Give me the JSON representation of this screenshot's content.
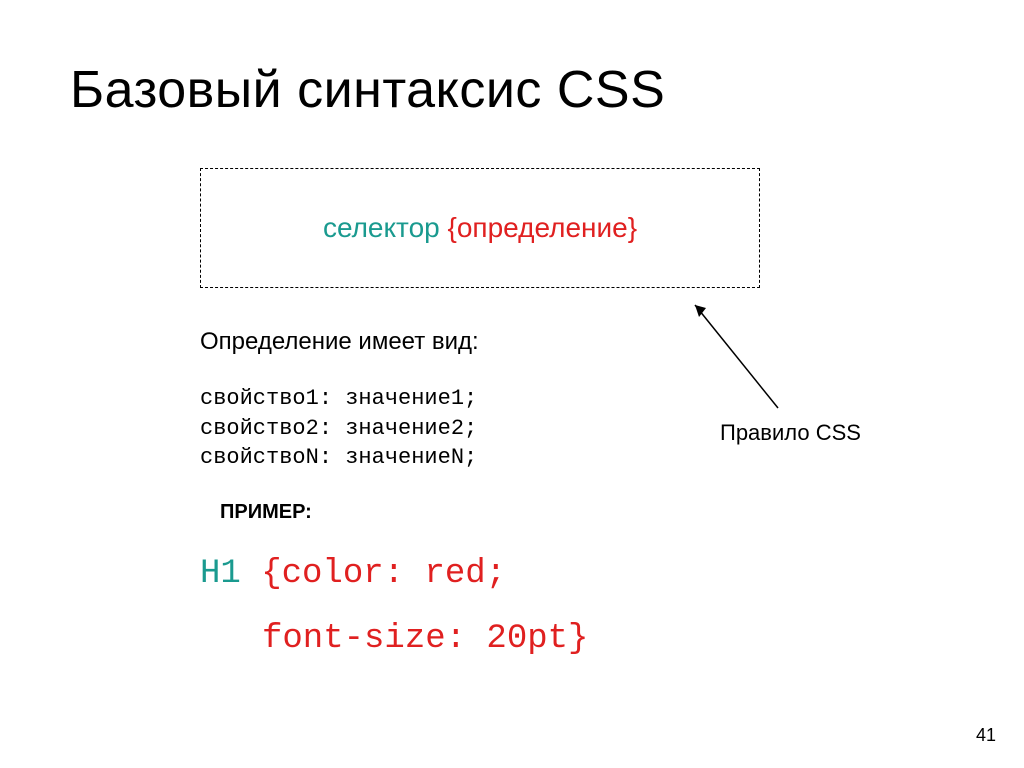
{
  "title": "Базовый синтаксис CSS",
  "rule_box": {
    "selector": "селектор",
    "brace_open": "{ ",
    "definition": "определение",
    "brace_close": " }"
  },
  "defn_label": "Определение имеет вид:",
  "props": {
    "line1": "свойство1: значение1;",
    "line2": "свойство2: значение2;",
    "line3": "свойствоN: значениеN;"
  },
  "example_label": "ПРИМЕР:",
  "example": {
    "selector": "H1",
    "decl_open": " {color: red;",
    "decl_line2": "font-size: 20pt}"
  },
  "rule_caption": "Правило CSS",
  "page_number": "41"
}
